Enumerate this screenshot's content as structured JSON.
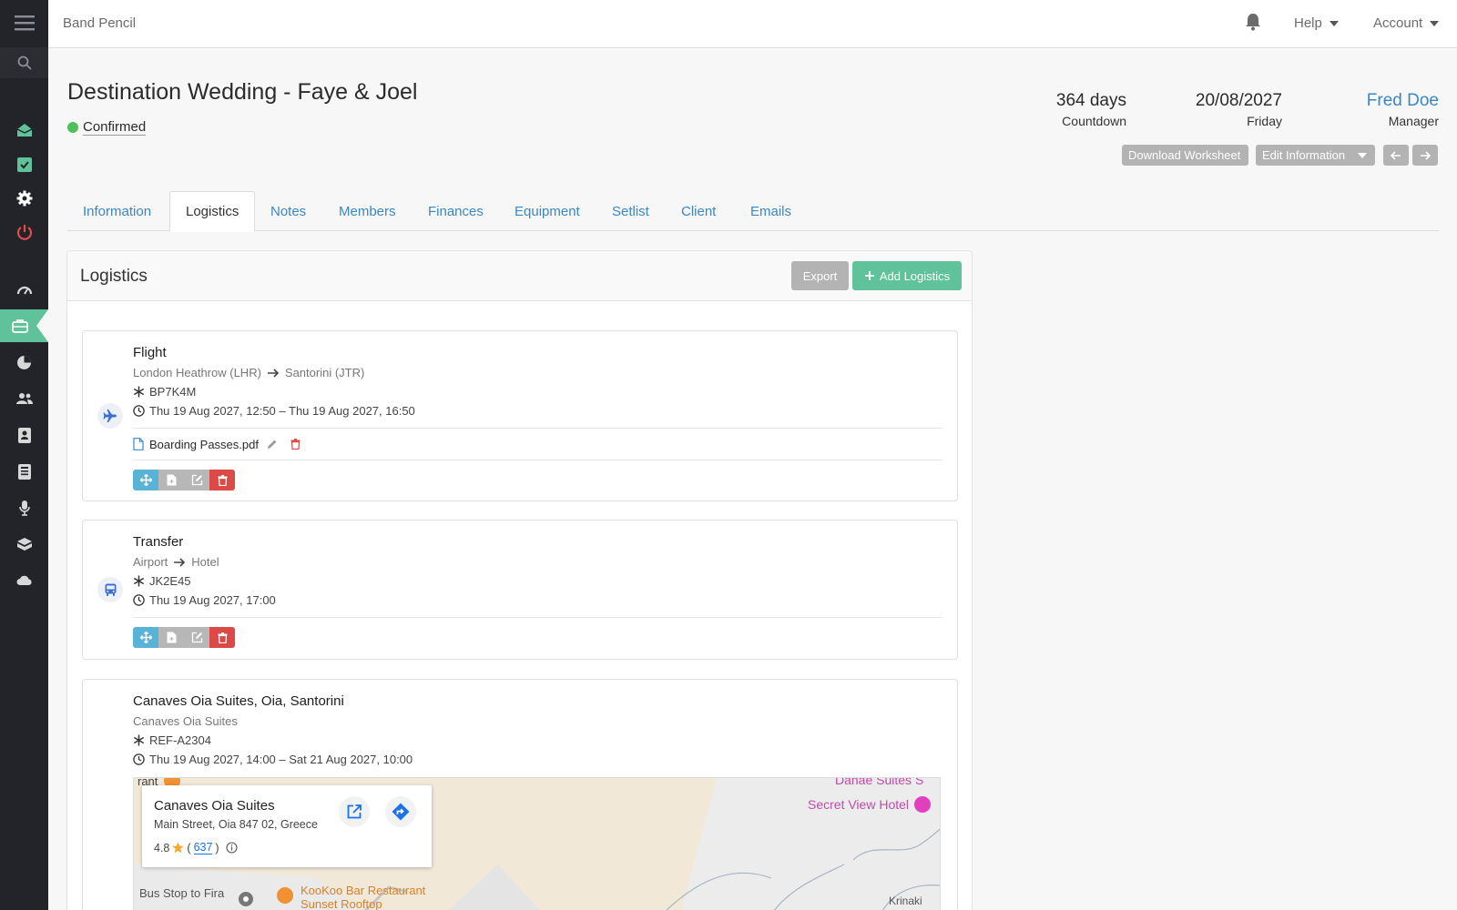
{
  "app": {
    "brand": "Band Pencil"
  },
  "topbar": {
    "help": "Help",
    "account": "Account"
  },
  "event": {
    "title": "Destination Wedding - Faye & Joel",
    "status": "Confirmed",
    "status_color": "#4fbf5b",
    "countdown_value": "364 days",
    "countdown_label": "Countdown",
    "date_value": "20/08/2027",
    "date_label": "Friday",
    "manager_value": "Fred Doe",
    "manager_label": "Manager"
  },
  "buttons": {
    "download": "Download Worksheet",
    "edit": "Edit Information"
  },
  "tabs": [
    "Information",
    "Logistics",
    "Notes",
    "Members",
    "Finances",
    "Equipment",
    "Setlist",
    "Client",
    "Emails"
  ],
  "active_tab": "Logistics",
  "panel": {
    "title": "Logistics",
    "export": "Export",
    "add": "Add Logistics"
  },
  "logistics": [
    {
      "type_icon": "plane-icon",
      "title": "Flight",
      "from": "London Heathrow (LHR)",
      "to": "Santorini (JTR)",
      "reference": "BP7K4M",
      "time": "Thu 19 Aug 2027, 12:50 – Thu 19 Aug 2027, 16:50",
      "file": "Boarding Passes.pdf"
    },
    {
      "type_icon": "bus-icon",
      "title": "Transfer",
      "from": "Airport",
      "to": "Hotel",
      "reference": "JK2E45",
      "time": "Thu 19 Aug 2027, 17:00"
    },
    {
      "title": "Canaves Oia Suites, Oia, Santorini",
      "subtitle": "Canaves Oia Suites",
      "reference": "REF-A2304",
      "time": "Thu 19 Aug 2027, 14:00 – Sat 21 Aug 2027, 10:00"
    }
  ],
  "map": {
    "place_name": "Canaves Oia Suites",
    "address": "Main Street, Oia 847 02, Greece",
    "rating": "4.8",
    "review_count": "637",
    "labels": {
      "danae": "Danae Suites S",
      "secret_view": "Secret View Hotel",
      "bus_stop": "Bus Stop to Fira",
      "kookoo": "KooKoo Bar Restaurant",
      "kookoo2": "Sunset Rooftop",
      "krinaki": "Krinaki",
      "cut": "rant"
    }
  },
  "colors": {
    "accent": "#5fc29a",
    "link": "#3a87c5",
    "sidebar": "#222429",
    "danger": "#dc4a47"
  }
}
